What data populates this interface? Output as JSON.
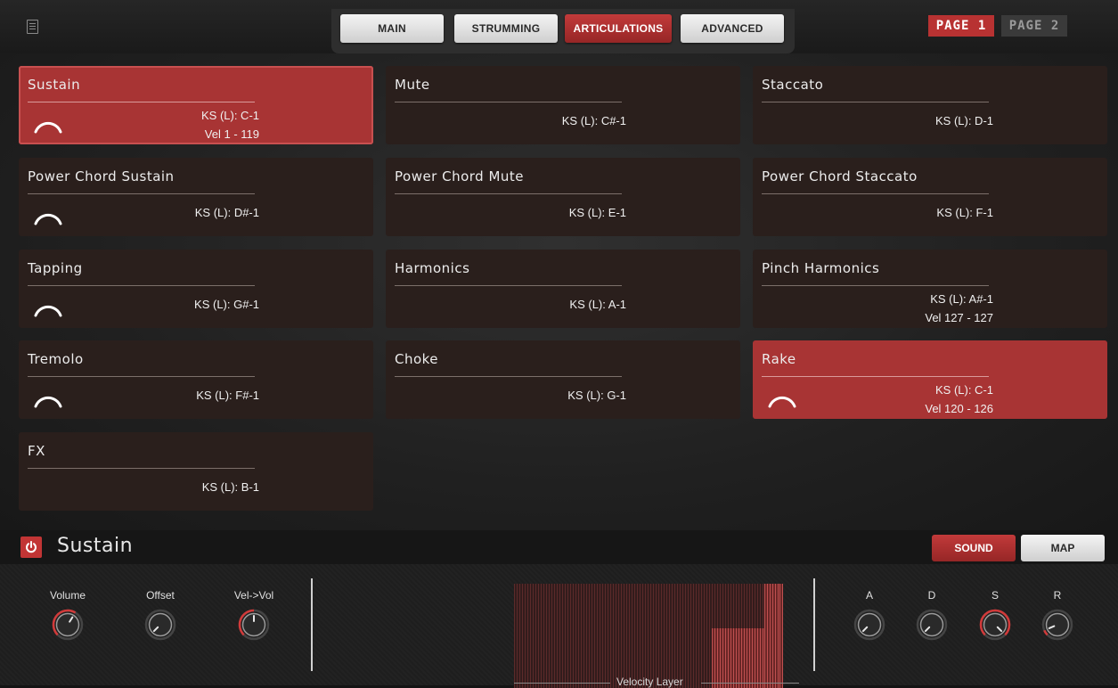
{
  "header": {
    "tabs": [
      {
        "label": "MAIN",
        "active": false
      },
      {
        "label": "STRUMMING",
        "active": false
      },
      {
        "label": "ARTICULATIONS",
        "active": true
      },
      {
        "label": "ADVANCED",
        "active": false
      }
    ],
    "pages": [
      {
        "label": "PAGE 1",
        "active": true
      },
      {
        "label": "PAGE 2",
        "active": false
      }
    ]
  },
  "articulations": [
    {
      "name": "Sustain",
      "ks": "KS (L): C-1",
      "vel": "Vel 1 - 119",
      "selected": true,
      "icon": true
    },
    {
      "name": "Mute",
      "ks": "KS (L): C#-1",
      "vel": "",
      "selected": false,
      "icon": false
    },
    {
      "name": "Staccato",
      "ks": "KS (L): D-1",
      "vel": "",
      "selected": false,
      "icon": false
    },
    {
      "name": "Power Chord Sustain",
      "ks": "KS (L): D#-1",
      "vel": "",
      "selected": false,
      "icon": true
    },
    {
      "name": "Power Chord Mute",
      "ks": "KS (L): E-1",
      "vel": "",
      "selected": false,
      "icon": false
    },
    {
      "name": "Power Chord Staccato",
      "ks": "KS (L): F-1",
      "vel": "",
      "selected": false,
      "icon": false
    },
    {
      "name": "Tapping",
      "ks": "KS (L): G#-1",
      "vel": "",
      "selected": false,
      "icon": true
    },
    {
      "name": "Harmonics",
      "ks": "KS (L): A-1",
      "vel": "",
      "selected": false,
      "icon": false
    },
    {
      "name": "Pinch Harmonics",
      "ks": "KS (L): A#-1",
      "vel": "Vel 127 - 127",
      "selected": false,
      "icon": false
    },
    {
      "name": "Tremolo",
      "ks": "KS (L): F#-1",
      "vel": "",
      "selected": false,
      "icon": true
    },
    {
      "name": "Choke",
      "ks": "KS (L): G-1",
      "vel": "",
      "selected": false,
      "icon": false
    },
    {
      "name": "Rake",
      "ks": "KS (L): C-1",
      "vel": "Vel 120 - 126",
      "selected": true,
      "icon": true
    },
    {
      "name": "FX",
      "ks": "KS (L): B-1",
      "vel": "",
      "selected": false,
      "icon": false
    }
  ],
  "panel": {
    "title": "Sustain",
    "sound_label": "SOUND",
    "map_label": "MAP",
    "knobs_left": [
      {
        "label": "Volume",
        "value": 0.62
      },
      {
        "label": "Offset",
        "value": 0.0
      },
      {
        "label": "Vel->Vol",
        "value": 0.5
      }
    ],
    "knobs_right": [
      {
        "label": "A",
        "value": 0.0
      },
      {
        "label": "D",
        "value": 0.0
      },
      {
        "label": "S",
        "value": 1.0
      },
      {
        "label": "R",
        "value": 0.08
      }
    ],
    "velocity_caption": "Velocity Layer",
    "velocity_layers": [
      {
        "from": 1,
        "to": 119
      },
      {
        "from": 120,
        "to": 126
      },
      {
        "from": 127,
        "to": 127
      }
    ]
  },
  "colors": {
    "accent": "#b83232",
    "card_bg": "#2a1f1c"
  }
}
